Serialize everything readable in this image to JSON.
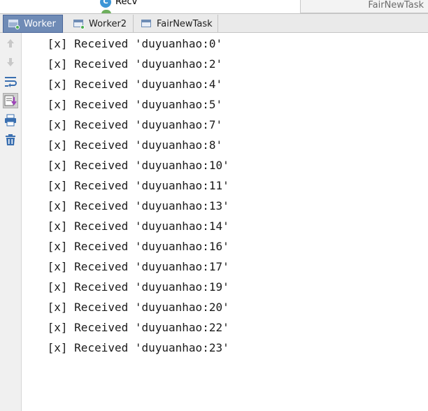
{
  "tree": {
    "item_label": "Recv",
    "item_icon": "class-c-icon",
    "item_icon_letter": "C"
  },
  "side_panel": {
    "title": "FairNewTask"
  },
  "tabs": [
    {
      "label": "Worker",
      "active": true,
      "icon": "run-window-icon"
    },
    {
      "label": "Worker2",
      "active": false,
      "icon": "run-window-icon"
    },
    {
      "label": "FairNewTask",
      "active": false,
      "icon": "run-window-icon"
    }
  ],
  "toolbar": {
    "tools": [
      {
        "name": "up-arrow-icon",
        "label": "Up to previous"
      },
      {
        "name": "down-arrow-icon",
        "label": "Down to next"
      },
      {
        "name": "soft-wrap-icon",
        "label": "Soft-wrap"
      },
      {
        "name": "scroll-to-end-icon",
        "label": "Scroll to end",
        "pressed": true
      },
      {
        "name": "print-icon",
        "label": "Print"
      },
      {
        "name": "trash-icon",
        "label": "Clear all"
      }
    ]
  },
  "console": {
    "lines": [
      " [x] Received 'duyuanhao:0'",
      " [x] Received 'duyuanhao:2'",
      " [x] Received 'duyuanhao:4'",
      " [x] Received 'duyuanhao:5'",
      " [x] Received 'duyuanhao:7'",
      " [x] Received 'duyuanhao:8'",
      " [x] Received 'duyuanhao:10'",
      " [x] Received 'duyuanhao:11'",
      " [x] Received 'duyuanhao:13'",
      " [x] Received 'duyuanhao:14'",
      " [x] Received 'duyuanhao:16'",
      " [x] Received 'duyuanhao:17'",
      " [x] Received 'duyuanhao:19'",
      " [x] Received 'duyuanhao:20'",
      " [x] Received 'duyuanhao:22'",
      " [x] Received 'duyuanhao:23'"
    ]
  },
  "colors": {
    "active_tab": "#6f8bb6",
    "class_icon": "#3c96d6"
  }
}
